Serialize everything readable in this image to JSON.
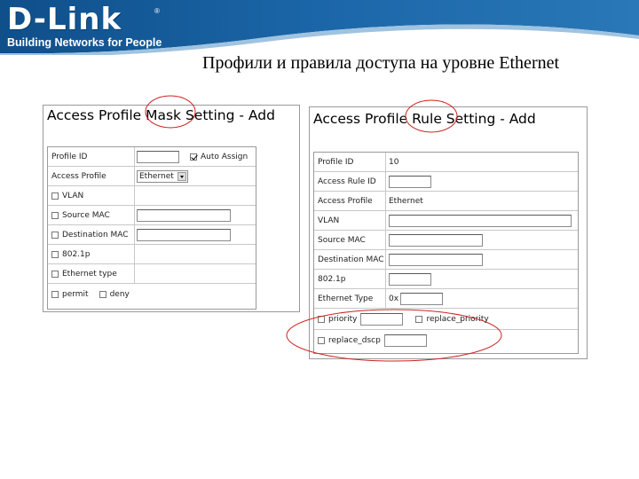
{
  "brand": {
    "name": "D-Link",
    "registered_mark": "®",
    "tagline": "Building Networks for People",
    "colors": {
      "header_blue": "#1a5e9a",
      "header_light": "#d6e6f3"
    }
  },
  "slide_title": "Профили и правила доступа на уровне Ethernet",
  "mask_panel": {
    "title": "Access Profile Mask Setting - Add",
    "rows": {
      "profile_id": {
        "label": "Profile ID",
        "auto_assign_label": "Auto Assign",
        "auto_assign_checked": true
      },
      "access_profile": {
        "label": "Access Profile",
        "selected": "Ethernet"
      },
      "vlan": {
        "label": "VLAN"
      },
      "source_mac": {
        "label": "Source MAC"
      },
      "destination_mac": {
        "label": "Destination MAC"
      },
      "dot1p": {
        "label": "802.1p"
      },
      "ethernet_type": {
        "label": "Ethernet type"
      },
      "permit": {
        "label": "permit"
      },
      "deny": {
        "label": "deny"
      }
    }
  },
  "rule_panel": {
    "title": "Access Profile Rule Setting - Add",
    "rows": {
      "profile_id": {
        "label": "Profile ID",
        "value": "10"
      },
      "access_rule_id": {
        "label": "Access Rule ID"
      },
      "access_profile": {
        "label": "Access Profile",
        "value": "Ethernet"
      },
      "vlan": {
        "label": "VLAN"
      },
      "source_mac": {
        "label": "Source MAC"
      },
      "destination_mac": {
        "label": "Destination MAC"
      },
      "dot1p": {
        "label": "802.1p"
      },
      "ethernet_type": {
        "label": "Ethernet Type",
        "prefix": "0x"
      },
      "priority": {
        "label": "priority"
      },
      "replace_priority": {
        "label": "replace_priority"
      },
      "replace_dscp": {
        "label": "replace_dscp"
      }
    }
  },
  "annotation_color": "#cc2222"
}
